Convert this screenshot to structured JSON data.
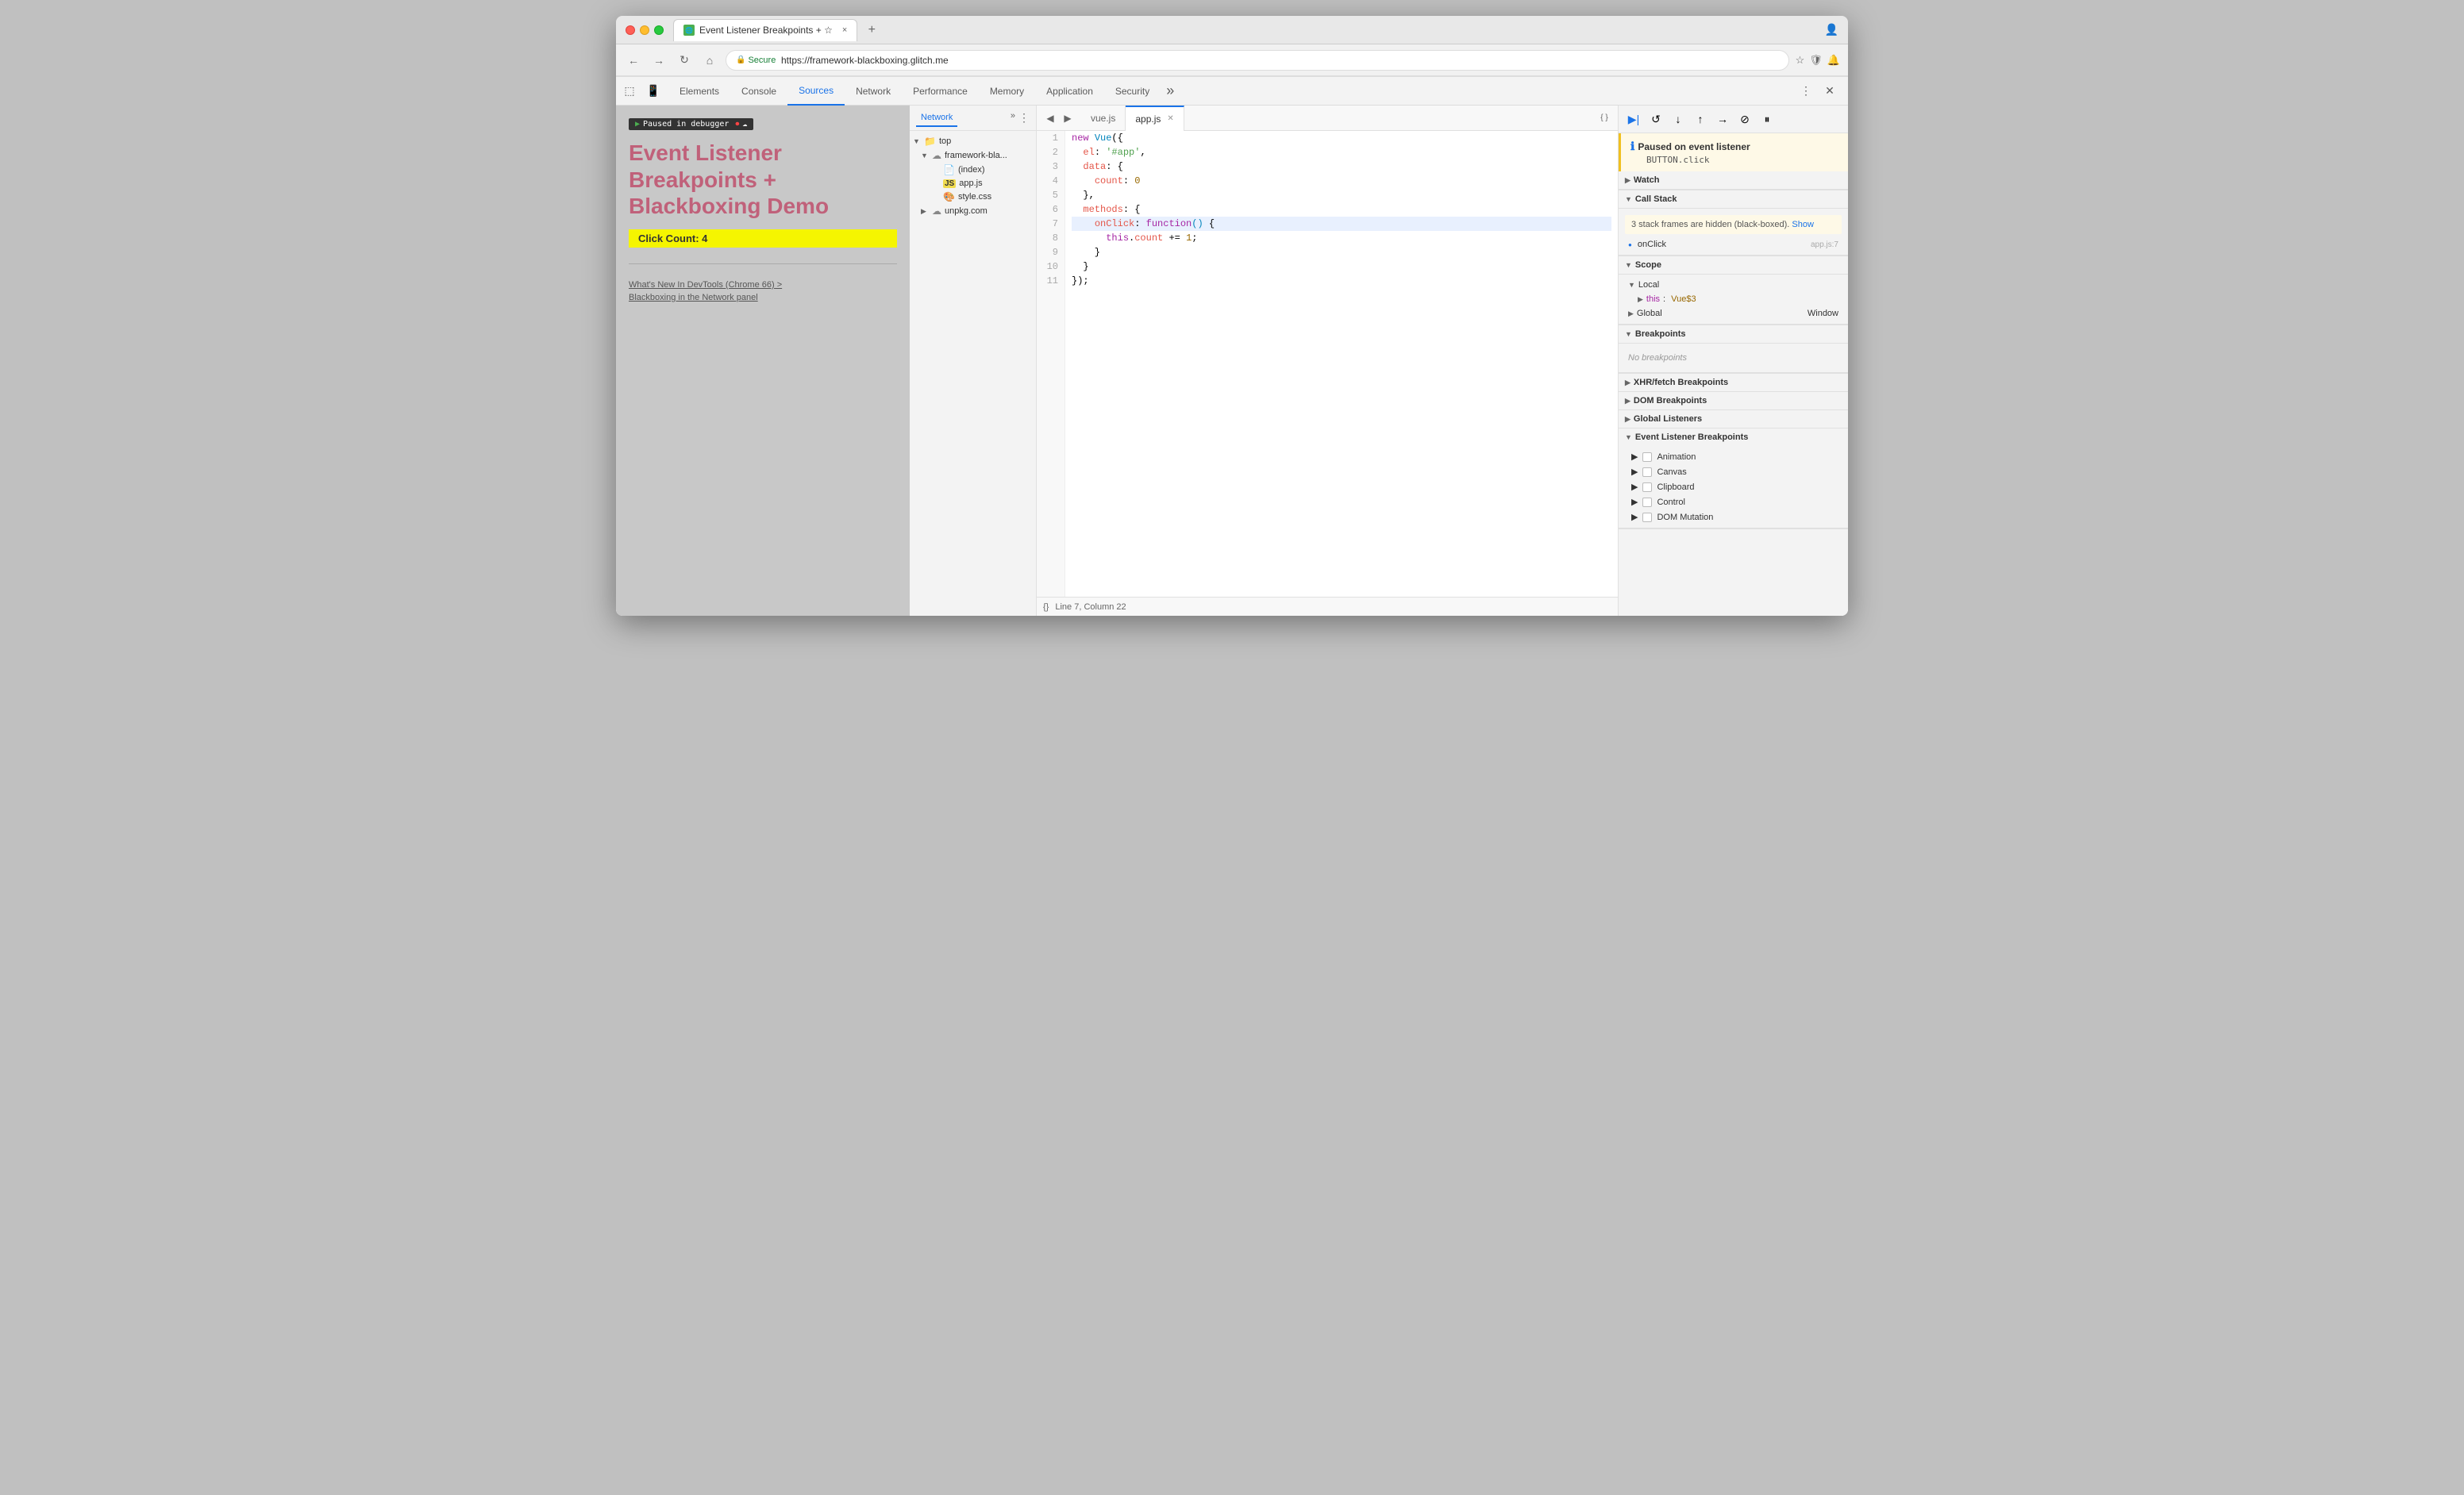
{
  "window": {
    "title": "Event Listener Breakpoints + ☆",
    "favicon": "🌐",
    "tab_close": "×",
    "new_tab": "+"
  },
  "addressbar": {
    "url": "https://framework-blackboxing.glitch.me",
    "secure_label": "Secure",
    "back": "←",
    "forward": "→",
    "refresh": "↻",
    "home": "⌂"
  },
  "devtools": {
    "tabs": [
      "Elements",
      "Console",
      "Sources",
      "Network",
      "Performance",
      "Memory",
      "Application",
      "Security"
    ],
    "active_tab": "Sources",
    "overflow": "»",
    "close": "×"
  },
  "page": {
    "debugger_badge": "Paused in debugger",
    "title": "Event Listener Breakpoints + Blackboxing Demo",
    "click_count": "Click Count: 4",
    "links": [
      "What's New In DevTools (Chrome 66) >",
      "Blackboxing in the Network panel"
    ]
  },
  "file_tree": {
    "tab_network": "Network",
    "tab_overflow": "»",
    "items": [
      {
        "label": "top",
        "indent": 0,
        "type": "folder",
        "arrow": "▼"
      },
      {
        "label": "framework-bla...",
        "indent": 1,
        "type": "cloud",
        "arrow": "▼"
      },
      {
        "label": "(index)",
        "indent": 2,
        "type": "html",
        "arrow": ""
      },
      {
        "label": "app.js",
        "indent": 2,
        "type": "js",
        "arrow": ""
      },
      {
        "label": "style.css",
        "indent": 2,
        "type": "css",
        "arrow": ""
      },
      {
        "label": "unpkg.com",
        "indent": 1,
        "type": "cloud",
        "arrow": "▶"
      }
    ]
  },
  "editor": {
    "files": [
      "vue.js",
      "app.js"
    ],
    "active_file": "app.js",
    "lines": [
      {
        "num": 1,
        "code": "new Vue({",
        "highlight": false
      },
      {
        "num": 2,
        "code": "  el: '#app',",
        "highlight": false
      },
      {
        "num": 3,
        "code": "  data: {",
        "highlight": false
      },
      {
        "num": 4,
        "code": "    count: 0",
        "highlight": false
      },
      {
        "num": 5,
        "code": "  },",
        "highlight": false
      },
      {
        "num": 6,
        "code": "  methods: {",
        "highlight": false
      },
      {
        "num": 7,
        "code": "    onClick: function() {",
        "highlight": true
      },
      {
        "num": 8,
        "code": "      this.count += 1;",
        "highlight": false
      },
      {
        "num": 9,
        "code": "    }",
        "highlight": false
      },
      {
        "num": 10,
        "code": "  }",
        "highlight": false
      },
      {
        "num": 11,
        "code": "});",
        "highlight": false
      }
    ],
    "status": "Line 7, Column 22",
    "format_icon": "{}"
  },
  "debug": {
    "toolbar_buttons": [
      "resume",
      "step_over",
      "step_into",
      "step_out",
      "step",
      "deactivate"
    ],
    "pause_title": "Paused on event listener",
    "pause_event": "BUTTON.click",
    "sections": {
      "watch": "Watch",
      "call_stack": "Call Stack",
      "blackbox_msg": "3 stack frames are hidden (black-boxed).",
      "blackbox_show": "Show",
      "onclick_label": "onClick",
      "onclick_file": "app.js:7",
      "scope": "Scope",
      "local": "Local",
      "local_this": "this",
      "local_this_val": "Vue$3",
      "global": "Global",
      "global_val": "Window",
      "breakpoints": "Breakpoints",
      "no_breakpoints": "No breakpoints",
      "xhr_breakpoints": "XHR/fetch Breakpoints",
      "dom_breakpoints": "DOM Breakpoints",
      "global_listeners": "Global Listeners",
      "event_listener_breakpoints": "Event Listener Breakpoints",
      "event_items": [
        "Animation",
        "Canvas",
        "Clipboard",
        "Control",
        "DOM Mutation"
      ]
    }
  }
}
